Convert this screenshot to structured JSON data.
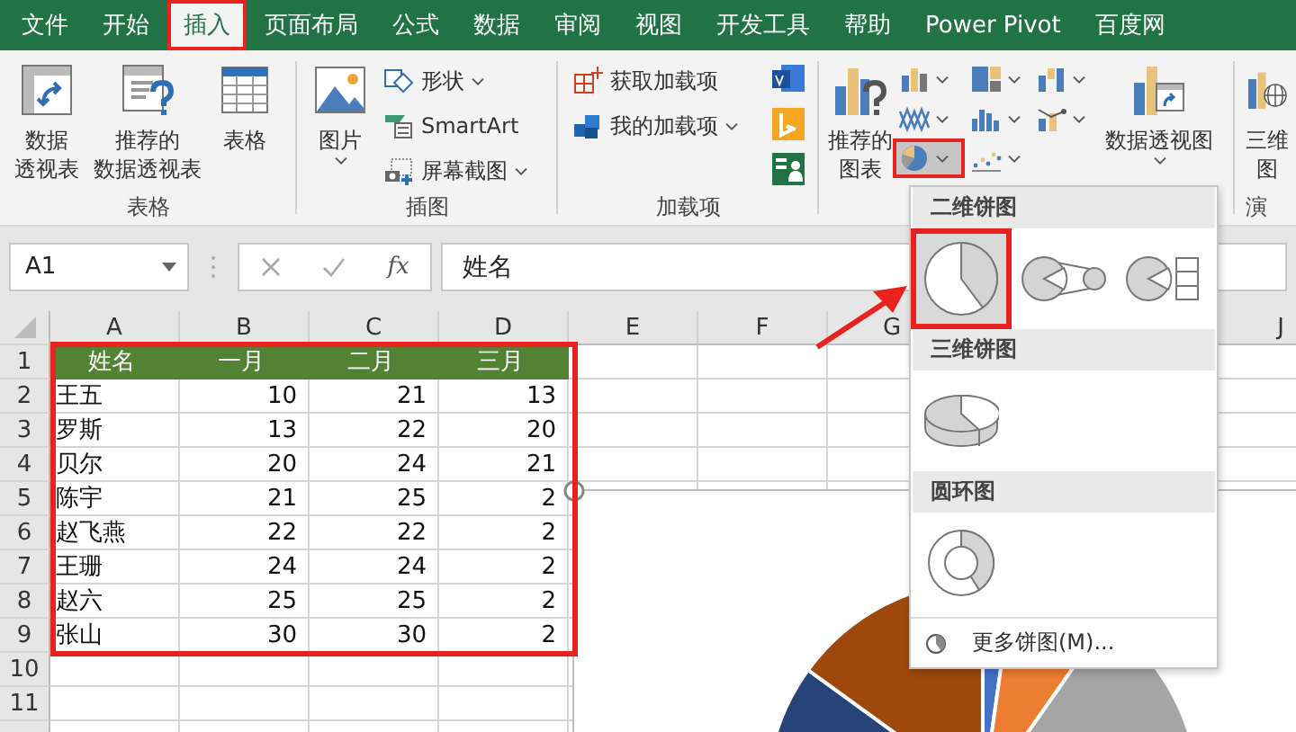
{
  "tabs": [
    {
      "label": "文件",
      "selected": false
    },
    {
      "label": "开始",
      "selected": false
    },
    {
      "label": "插入",
      "selected": true
    },
    {
      "label": "页面布局",
      "selected": false
    },
    {
      "label": "公式",
      "selected": false
    },
    {
      "label": "数据",
      "selected": false
    },
    {
      "label": "审阅",
      "selected": false
    },
    {
      "label": "视图",
      "selected": false
    },
    {
      "label": "开发工具",
      "selected": false
    },
    {
      "label": "帮助",
      "selected": false
    },
    {
      "label": "Power Pivot",
      "selected": false
    },
    {
      "label": "百度网",
      "selected": false
    }
  ],
  "ribbon_groups": [
    {
      "label": "表格",
      "items": [
        {
          "kind": "large",
          "lines": [
            "数据",
            "透视表"
          ]
        },
        {
          "kind": "large",
          "lines": [
            "推荐的",
            "数据透视表"
          ]
        },
        {
          "kind": "large",
          "lines": [
            "表格"
          ]
        }
      ]
    },
    {
      "label": "插图",
      "items": [
        {
          "kind": "large",
          "lines": [
            "图片"
          ],
          "dropdown": true
        },
        {
          "kind": "stack",
          "entries": [
            {
              "label": "形状",
              "dropdown": true
            },
            {
              "label": "SmartArt",
              "dropdown": false
            },
            {
              "label": "屏幕截图",
              "dropdown": true
            }
          ]
        }
      ]
    },
    {
      "label": "加载项",
      "items": [
        {
          "kind": "stack",
          "entries": [
            {
              "label": "获取加载项",
              "dropdown": false
            },
            {
              "label": "我的加载项",
              "dropdown": true
            }
          ]
        },
        {
          "kind": "app-icons"
        }
      ]
    },
    {
      "items": [
        {
          "kind": "large",
          "lines": [
            "推荐的",
            "图表"
          ]
        },
        {
          "kind": "gallery",
          "buttons": [
            {
              "selected": false
            },
            {
              "selected": false
            },
            {
              "selected": false
            },
            {
              "selected": false
            },
            {
              "selected": false
            },
            {
              "selected": false
            },
            {
              "selected": true
            },
            {
              "selected": false
            }
          ]
        },
        {
          "kind": "large",
          "lines": [
            "数据透视图"
          ],
          "dropdown": true
        }
      ]
    },
    {
      "label": "演",
      "items": [
        {
          "kind": "large",
          "lines": [
            "三维",
            "图"
          ]
        }
      ]
    }
  ],
  "formula_bar": {
    "name_box": "A1",
    "fx": "fx",
    "formula": "姓名"
  },
  "sheet": {
    "columns_left": [
      "A",
      "B",
      "C",
      "D",
      "E",
      "F",
      "G"
    ],
    "columns_right": [
      "J"
    ],
    "rows": [
      {
        "number": "1",
        "kind": "header",
        "cells": [
          "姓名",
          "一月",
          "二月",
          "三月"
        ]
      },
      {
        "number": "2",
        "kind": "data",
        "cells": [
          "王五",
          "10",
          "21",
          "13"
        ]
      },
      {
        "number": "3",
        "kind": "data",
        "cells": [
          "罗斯",
          "13",
          "22",
          "20"
        ]
      },
      {
        "number": "4",
        "kind": "data",
        "cells": [
          "贝尔",
          "20",
          "24",
          "21"
        ]
      },
      {
        "number": "5",
        "kind": "data",
        "cells": [
          "陈宇",
          "21",
          "25",
          "2"
        ]
      },
      {
        "number": "6",
        "kind": "data",
        "cells": [
          "赵飞燕",
          "22",
          "22",
          "2"
        ]
      },
      {
        "number": "7",
        "kind": "data",
        "cells": [
          "王珊",
          "24",
          "24",
          "2"
        ]
      },
      {
        "number": "8",
        "kind": "data",
        "cells": [
          "赵六",
          "25",
          "25",
          "2"
        ]
      },
      {
        "number": "9",
        "kind": "data",
        "cells": [
          "张山",
          "30",
          "30",
          "2"
        ]
      },
      {
        "number": "10",
        "kind": "data"
      },
      {
        "number": "11",
        "kind": "data"
      }
    ]
  },
  "pie_menu": {
    "sections": [
      {
        "title": "二维饼图",
        "options": [
          {
            "kind": "pie",
            "selected": true
          },
          {
            "kind": "pie-of-pie",
            "selected": false
          },
          {
            "kind": "bar-of-pie",
            "selected": false
          }
        ]
      },
      {
        "title": "三维饼图",
        "options": [
          {
            "kind": "pie-3d",
            "selected": false
          }
        ]
      },
      {
        "title": "圆环图",
        "options": [
          {
            "kind": "donut",
            "selected": false
          }
        ]
      }
    ],
    "footer": "更多饼图(M)..."
  }
}
